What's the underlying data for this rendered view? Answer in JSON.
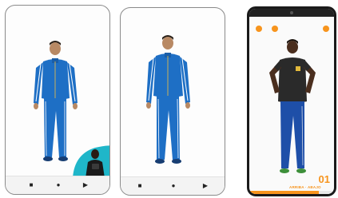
{
  "phone3": {
    "counter": "01",
    "caption": "ARRIBA · ABAJO",
    "progress": 0.82
  },
  "nav_icons": [
    "stop-square-icon",
    "home-dot-icon",
    "back-triangle-icon"
  ],
  "colors": {
    "accent": "#f7941d",
    "tracksuit": "#1e6fc5",
    "shirt": "#2a2a2a",
    "teal_blob": "#1fb6c9"
  }
}
